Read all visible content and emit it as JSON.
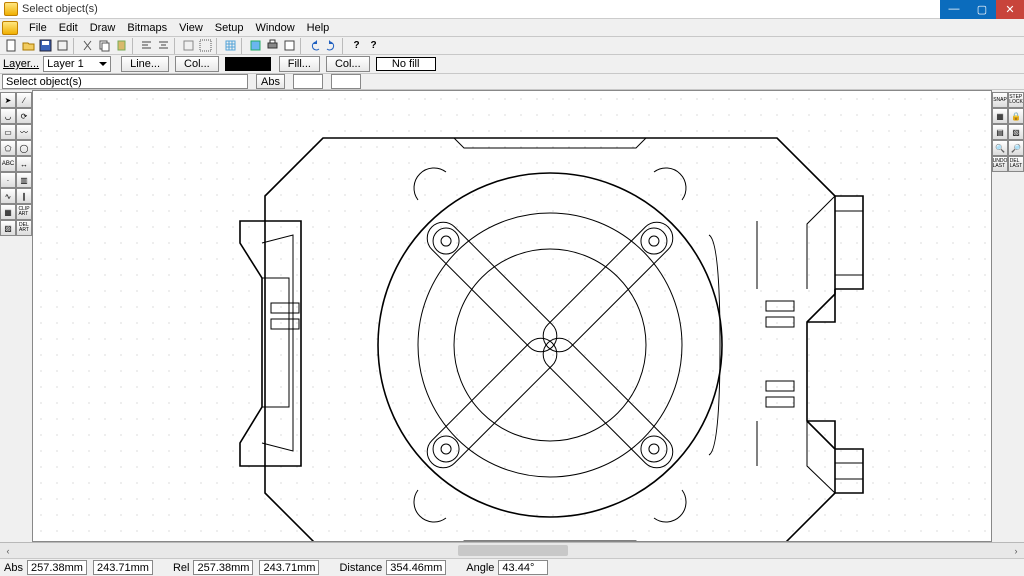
{
  "title": "Select object(s)",
  "menus": [
    "File",
    "Edit",
    "Draw",
    "Bitmaps",
    "View",
    "Setup",
    "Window",
    "Help"
  ],
  "toolbar2": {
    "layer_lbl": "Layer...",
    "layer_val": "Layer 1",
    "line_btn": "Line...",
    "col_btn": "Col...",
    "fill_btn": "Fill...",
    "col2_btn": "Col...",
    "nofill": "No fill"
  },
  "status_prompt": "Select object(s)",
  "status_abs": "Abs",
  "bottom": {
    "abs": "Abs",
    "abs_x": "257.38mm",
    "abs_y": "243.71mm",
    "rel": "Rel",
    "rel_x": "257.38mm",
    "rel_y": "243.71mm",
    "dist": "Distance",
    "dist_v": "354.46mm",
    "ang": "Angle",
    "ang_v": "43.44°"
  },
  "right_labels": {
    "snap": "SNAP",
    "step_lock": "STEP\nLOCK",
    "undo_last": "UNDO\nLAST",
    "del_last": "DEL\nLAST"
  },
  "left_labels": {
    "abc": "ABC",
    "clip_art": "CLIP\nART",
    "del_art": "DEL\nART"
  }
}
